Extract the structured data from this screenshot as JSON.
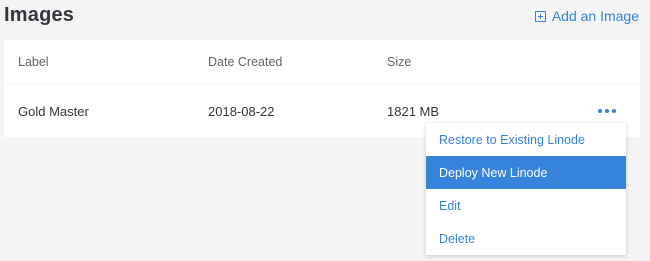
{
  "header": {
    "title": "Images",
    "add_label": "Add an Image"
  },
  "table": {
    "columns": [
      "Label",
      "Date Created",
      "Size"
    ],
    "rows": [
      {
        "label": "Gold Master",
        "date": "2018-08-22",
        "size": "1821 MB"
      }
    ]
  },
  "menu": {
    "items": [
      {
        "label": "Restore to Existing Linode",
        "active": false
      },
      {
        "label": "Deploy New Linode",
        "active": true
      },
      {
        "label": "Edit",
        "active": false
      },
      {
        "label": "Delete",
        "active": false
      }
    ]
  },
  "colors": {
    "accent": "#3683dc",
    "background": "#f4f4f4",
    "text": "#32363c"
  },
  "icons": {
    "add": "plus-square-icon",
    "actions": "more-horizontal-icon"
  }
}
